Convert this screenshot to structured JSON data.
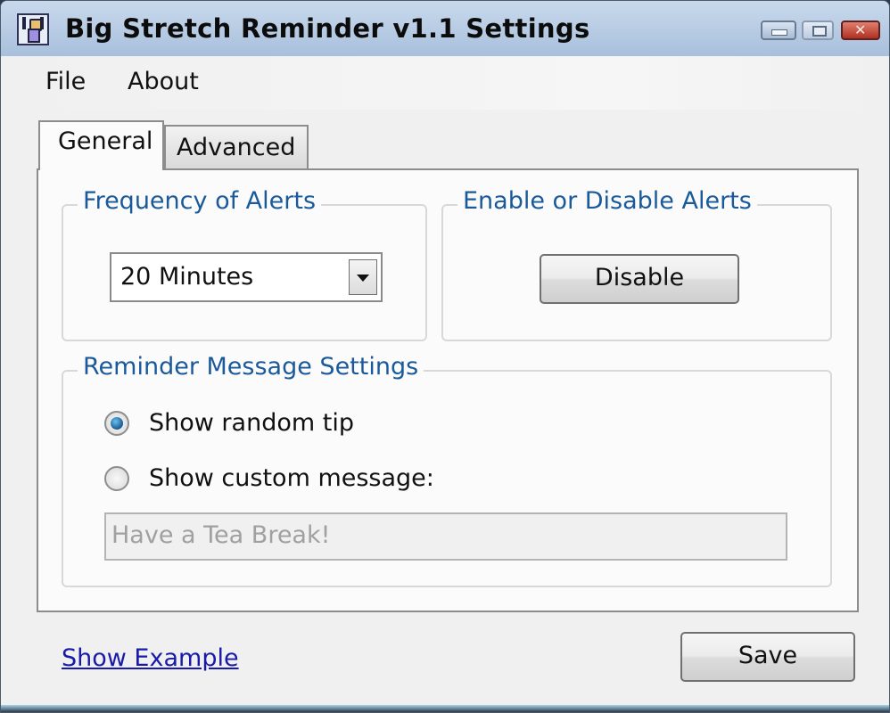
{
  "window": {
    "title": "Big Stretch Reminder v1.1 Settings",
    "controls": {
      "minimize": "minimize",
      "maximize": "maximize",
      "close": "close"
    }
  },
  "menu": {
    "items": [
      {
        "label": "File"
      },
      {
        "label": "About"
      }
    ]
  },
  "tabs": [
    {
      "label": "General",
      "active": true
    },
    {
      "label": "Advanced",
      "active": false
    }
  ],
  "general": {
    "frequency": {
      "group_label": "Frequency of Alerts",
      "selected": "20 Minutes"
    },
    "enable": {
      "group_label": "Enable or Disable Alerts",
      "button_label": "Disable"
    },
    "message": {
      "group_label": "Reminder Message Settings",
      "options": [
        {
          "label": "Show random tip",
          "checked": true
        },
        {
          "label": "Show custom message:",
          "checked": false
        }
      ],
      "custom_message_value": "Have a Tea Break!",
      "custom_message_enabled": false
    }
  },
  "footer": {
    "link_label": "Show Example",
    "save_label": "Save"
  },
  "colors": {
    "group_label": "#1a5a9a",
    "link": "#1a1aaa",
    "close_button": "#c04030"
  }
}
